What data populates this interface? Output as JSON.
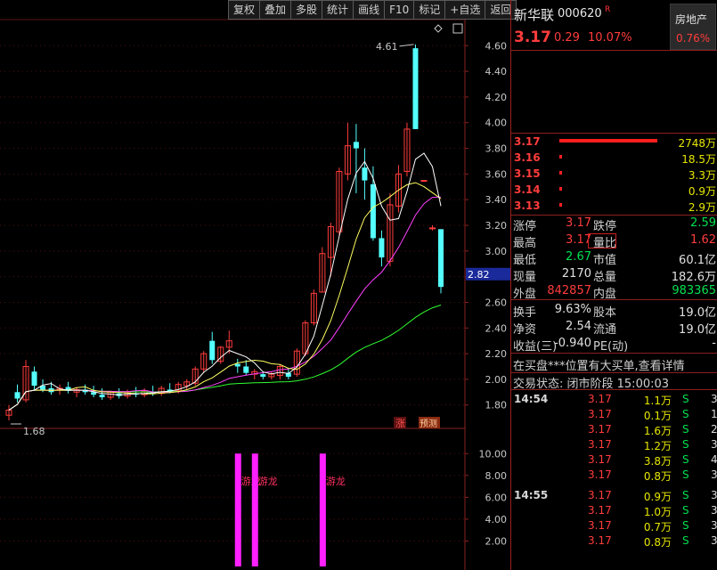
{
  "toolbar": [
    "复权",
    "叠加",
    "多股",
    "统计",
    "画线",
    "F10",
    "标记",
    "+自选",
    "返回"
  ],
  "stock": {
    "name": "新华联",
    "code": "000620",
    "badge": "R",
    "price": "3.17",
    "change": "0.29",
    "change_pct": "10.07%",
    "sector": "房地产",
    "sector_pct": "0.76%"
  },
  "order_book": [
    {
      "price": "3.17",
      "volume": "2748万",
      "fraction": 1.0
    },
    {
      "price": "3.16",
      "volume": "18.5万",
      "fraction": 0.01
    },
    {
      "price": "3.15",
      "volume": "3.3万",
      "fraction": 0.01
    },
    {
      "price": "3.14",
      "volume": "0.9万",
      "fraction": 0.01
    },
    {
      "price": "3.13",
      "volume": "2.9万",
      "fraction": 0.01
    }
  ],
  "stats": [
    {
      "l1": "涨停",
      "v1": "3.17",
      "c1": "#ff3c3c",
      "l2": "跌停",
      "v2": "2.59",
      "c2": "#00e050"
    },
    {
      "l1": "最高",
      "v1": "3.17",
      "c1": "#ff3c3c",
      "l2": "量比",
      "v2": "1.62",
      "c2": "#ff3c3c"
    },
    {
      "l1": "最低",
      "v1": "2.67",
      "c1": "#00e050",
      "l2": "市值",
      "v2": "60.1亿",
      "c2": "#e0e0e0"
    },
    {
      "l1": "现量",
      "v1": "2170",
      "c1": "#e0e0e0",
      "l2": "总量",
      "v2": "182.6万",
      "c2": "#e0e0e0"
    },
    {
      "l1": "外盘",
      "v1": "842857",
      "c1": "#ff3c3c",
      "l2": "内盘",
      "v2": "983365",
      "c2": "#00e050"
    },
    {
      "l1": "换手",
      "v1": "9.63%",
      "c1": "#e0e0e0",
      "l2": "股本",
      "v2": "19.0亿",
      "c2": "#e0e0e0"
    },
    {
      "l1": "净资",
      "v1": "2.54",
      "c1": "#e0e0e0",
      "l2": "流通",
      "v2": "19.0亿",
      "c2": "#e0e0e0"
    },
    {
      "l1": "收益(三)",
      "v1": "-0.940",
      "c1": "#e0e0e0",
      "l2": "PE(动)",
      "v2": "-",
      "c2": "#e0e0e0"
    }
  ],
  "notice": "在买盘***位置有大买单,查看详情",
  "status": "交易状态: 闭市阶段 15:00:03",
  "ticks": [
    {
      "time": "14:54",
      "price": "3.17",
      "vol": "1.1万",
      "side": "S",
      "cnt": "3"
    },
    {
      "time": "",
      "price": "3.17",
      "vol": "0.1万",
      "side": "S",
      "cnt": "1"
    },
    {
      "time": "",
      "price": "3.17",
      "vol": "1.6万",
      "side": "S",
      "cnt": "2"
    },
    {
      "time": "",
      "price": "3.17",
      "vol": "1.2万",
      "side": "S",
      "cnt": "3"
    },
    {
      "time": "",
      "price": "3.17",
      "vol": "3.8万",
      "side": "S",
      "cnt": "4"
    },
    {
      "time": "",
      "price": "3.17",
      "vol": "0.8万",
      "side": "S",
      "cnt": "3"
    },
    {
      "time": "14:55",
      "price": "3.17",
      "vol": "0.9万",
      "side": "S",
      "cnt": "3"
    },
    {
      "time": "",
      "price": "3.17",
      "vol": "1.0万",
      "side": "S",
      "cnt": "3"
    },
    {
      "time": "",
      "price": "3.17",
      "vol": "0.7万",
      "side": "S",
      "cnt": "3"
    },
    {
      "time": "",
      "price": "3.17",
      "vol": "0.8万",
      "side": "S",
      "cnt": "3"
    }
  ],
  "chart": {
    "high_label": "4.61",
    "low_label": "1.68",
    "current_price_tag": "2.82",
    "label_zhang": "涨",
    "label_yuce": "预测",
    "y_ticks": [
      "4.60",
      "4.40",
      "4.20",
      "4.00",
      "3.80",
      "3.60",
      "3.40",
      "3.20",
      "3.00",
      "2.80",
      "2.60",
      "2.40",
      "2.20",
      "2.00",
      "1.80"
    ],
    "sub_ticks": [
      "10.00",
      "8.00",
      "6.00",
      "4.00",
      "2.00"
    ],
    "signal_text": "游龙",
    "colors": {
      "up": "#ff3c3c",
      "down": "#54ffff",
      "ma5": "#ffffff",
      "ma10": "#ffff60",
      "ma20": "#ff40ff",
      "ma60": "#30ff30",
      "signal": "#ff20ff"
    }
  },
  "chart_data": {
    "type": "candlestick",
    "ylim": [
      1.68,
      4.72
    ],
    "candles": [
      {
        "o": 1.72,
        "h": 1.8,
        "l": 1.68,
        "c": 1.76
      },
      {
        "o": 1.9,
        "h": 1.96,
        "l": 1.82,
        "c": 1.85
      },
      {
        "o": 1.84,
        "h": 2.15,
        "l": 1.82,
        "c": 2.1
      },
      {
        "o": 2.06,
        "h": 2.1,
        "l": 1.92,
        "c": 1.95
      },
      {
        "o": 1.95,
        "h": 2.0,
        "l": 1.9,
        "c": 1.92
      },
      {
        "o": 1.93,
        "h": 1.98,
        "l": 1.88,
        "c": 1.9
      },
      {
        "o": 1.92,
        "h": 1.96,
        "l": 1.88,
        "c": 1.93
      },
      {
        "o": 1.94,
        "h": 1.98,
        "l": 1.89,
        "c": 1.91
      },
      {
        "o": 1.9,
        "h": 1.94,
        "l": 1.86,
        "c": 1.92
      },
      {
        "o": 1.92,
        "h": 1.96,
        "l": 1.88,
        "c": 1.9
      },
      {
        "o": 1.9,
        "h": 1.95,
        "l": 1.86,
        "c": 1.88
      },
      {
        "o": 1.88,
        "h": 1.93,
        "l": 1.84,
        "c": 1.86
      },
      {
        "o": 1.86,
        "h": 1.91,
        "l": 1.84,
        "c": 1.9
      },
      {
        "o": 1.89,
        "h": 1.93,
        "l": 1.85,
        "c": 1.87
      },
      {
        "o": 1.87,
        "h": 1.92,
        "l": 1.85,
        "c": 1.9
      },
      {
        "o": 1.89,
        "h": 1.94,
        "l": 1.86,
        "c": 1.88
      },
      {
        "o": 1.88,
        "h": 1.93,
        "l": 1.86,
        "c": 1.91
      },
      {
        "o": 1.9,
        "h": 1.95,
        "l": 1.87,
        "c": 1.89
      },
      {
        "o": 1.89,
        "h": 1.95,
        "l": 1.87,
        "c": 1.93
      },
      {
        "o": 1.92,
        "h": 1.97,
        "l": 1.89,
        "c": 1.9
      },
      {
        "o": 1.91,
        "h": 1.98,
        "l": 1.89,
        "c": 1.96
      },
      {
        "o": 1.95,
        "h": 2.0,
        "l": 1.92,
        "c": 1.98
      },
      {
        "o": 1.97,
        "h": 2.1,
        "l": 1.95,
        "c": 2.08
      },
      {
        "o": 2.08,
        "h": 2.22,
        "l": 2.05,
        "c": 2.2
      },
      {
        "o": 2.3,
        "h": 2.37,
        "l": 2.12,
        "c": 2.15
      },
      {
        "o": 2.14,
        "h": 2.26,
        "l": 2.12,
        "c": 2.25
      },
      {
        "o": 2.25,
        "h": 2.38,
        "l": 2.2,
        "c": 2.3
      },
      {
        "o": 2.12,
        "h": 2.16,
        "l": 2.05,
        "c": 2.1
      },
      {
        "o": 2.1,
        "h": 2.15,
        "l": 2.03,
        "c": 2.05
      },
      {
        "o": 2.04,
        "h": 2.08,
        "l": 2.0,
        "c": 2.06
      },
      {
        "o": 2.04,
        "h": 2.06,
        "l": 2.0,
        "c": 2.02
      },
      {
        "o": 2.02,
        "h": 2.06,
        "l": 2.0,
        "c": 2.04
      },
      {
        "o": 2.03,
        "h": 2.12,
        "l": 2.0,
        "c": 2.1
      },
      {
        "o": 2.05,
        "h": 2.08,
        "l": 2.0,
        "c": 2.02
      },
      {
        "o": 2.04,
        "h": 2.24,
        "l": 2.02,
        "c": 2.22
      },
      {
        "o": 2.2,
        "h": 2.46,
        "l": 2.18,
        "c": 2.44
      },
      {
        "o": 2.44,
        "h": 2.7,
        "l": 2.42,
        "c": 2.67
      },
      {
        "o": 2.68,
        "h": 3.03,
        "l": 2.68,
        "c": 2.98
      },
      {
        "o": 2.95,
        "h": 3.22,
        "l": 2.8,
        "c": 3.19
      },
      {
        "o": 3.15,
        "h": 3.65,
        "l": 3.12,
        "c": 3.62
      },
      {
        "o": 3.6,
        "h": 4.0,
        "l": 3.55,
        "c": 3.82
      },
      {
        "o": 3.85,
        "h": 3.99,
        "l": 3.45,
        "c": 3.8
      },
      {
        "o": 3.65,
        "h": 3.8,
        "l": 3.4,
        "c": 3.55
      },
      {
        "o": 3.52,
        "h": 3.66,
        "l": 3.08,
        "c": 3.1
      },
      {
        "o": 3.1,
        "h": 3.16,
        "l": 2.88,
        "c": 2.95
      },
      {
        "o": 2.92,
        "h": 3.45,
        "l": 2.88,
        "c": 3.36
      },
      {
        "o": 3.35,
        "h": 3.67,
        "l": 3.3,
        "c": 3.6
      },
      {
        "o": 3.62,
        "h": 4.0,
        "l": 3.58,
        "c": 3.95
      },
      {
        "o": 4.58,
        "h": 4.61,
        "l": 3.95,
        "c": 3.95
      },
      {
        "o": 3.55,
        "h": 3.55,
        "l": 3.55,
        "c": 3.55
      },
      {
        "o": 3.18,
        "h": 3.2,
        "l": 3.16,
        "c": 3.18
      },
      {
        "o": 3.17,
        "h": 3.17,
        "l": 2.67,
        "c": 2.72
      }
    ],
    "signals": [
      {
        "index": 27,
        "value": 10
      },
      {
        "index": 29,
        "value": 10
      },
      {
        "index": 37,
        "value": 10
      }
    ],
    "subplot_ylim": [
      0,
      11
    ]
  }
}
